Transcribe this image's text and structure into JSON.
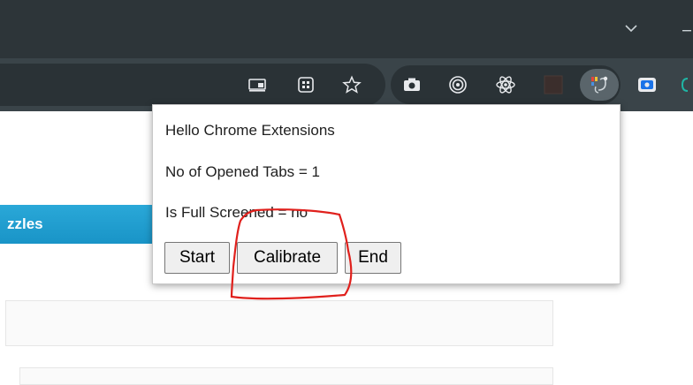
{
  "browser": {
    "titlebar_icons": [
      "chevron-down-icon",
      "minimize-icon"
    ],
    "toolbar_icons": [
      "cast-icon",
      "grid-icon",
      "star-icon"
    ],
    "extensions": [
      "camera-icon",
      "target-icon",
      "react-icon",
      "blank-extension-icon",
      "extension-active-icon",
      "screen-record-icon"
    ]
  },
  "page": {
    "banner_text": "zzles"
  },
  "popup": {
    "title": "Hello Chrome Extensions",
    "tabs_label": "No of Opened Tabs = 1",
    "fullscreen_label": "Is Full Screened = no",
    "buttons": {
      "start": "Start",
      "calibrate": "Calibrate",
      "end": "End"
    }
  },
  "annotation": {
    "color": "#e0201c"
  }
}
